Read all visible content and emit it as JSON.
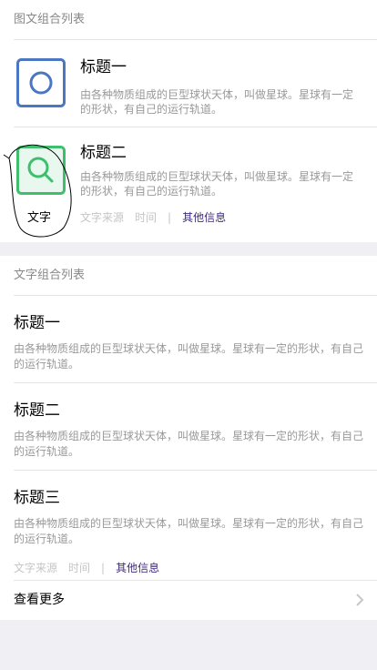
{
  "section1": {
    "title": "图文组合列表",
    "items": [
      {
        "title": "标题一",
        "desc": "由各种物质组成的巨型球状天体，叫做星球。星球有一定的形状，有自己的运行轨道。",
        "icon": "ring-icon",
        "icon_color": "#4a76c2"
      },
      {
        "title": "标题二",
        "desc": "由各种物质组成的巨型球状天体，叫做星球。星球有一定的形状，有自己的运行轨道。",
        "icon": "search-icon",
        "icon_color": "#3fbf6d",
        "meta": {
          "source": "文字来源",
          "time": "时间",
          "separator": "|",
          "extra": "其他信息"
        }
      }
    ],
    "annotation": "文字"
  },
  "section2": {
    "title": "文字组合列表",
    "items": [
      {
        "title": "标题一",
        "desc": "由各种物质组成的巨型球状天体，叫做星球。星球有一定的形状，有自己的运行轨道。"
      },
      {
        "title": "标题二",
        "desc": "由各种物质组成的巨型球状天体，叫做星球。星球有一定的形状，有自己的运行轨道。"
      },
      {
        "title": "标题三",
        "desc": "由各种物质组成的巨型球状天体，叫做星球。星球有一定的形状，有自己的运行轨道。",
        "meta": {
          "source": "文字来源",
          "time": "时间",
          "separator": "|",
          "extra": "其他信息"
        }
      }
    ],
    "more_label": "查看更多"
  }
}
